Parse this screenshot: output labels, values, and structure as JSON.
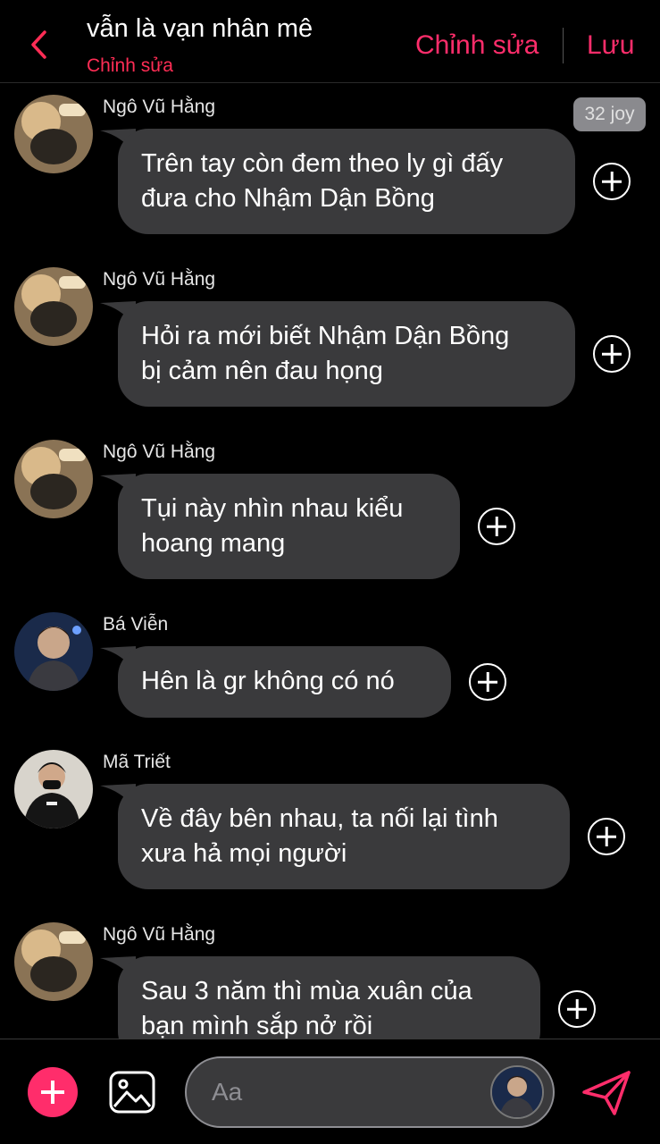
{
  "header": {
    "title": "vẫn là vạn nhân mê",
    "subtitle": "Chỉnh sửa",
    "edit_label": "Chỉnh sửa",
    "save_label": "Lưu"
  },
  "badge": "32 joy",
  "messages": [
    {
      "sender": "Ngô Vũ Hằng",
      "lines": [
        "Trên tay còn đem theo ly gì đấy",
        "đưa cho Nhậm Dận Bồng"
      ]
    },
    {
      "sender": "Ngô Vũ Hằng",
      "lines": [
        "Hỏi ra mới biết Nhậm Dận Bồng",
        "bị cảm nên đau họng"
      ]
    },
    {
      "sender": "Ngô Vũ Hằng",
      "lines": [
        "Tụi này nhìn nhau kiểu",
        "hoang mang"
      ]
    },
    {
      "sender": "Bá Viễn",
      "lines": [
        "Hên là gr không có nó"
      ]
    },
    {
      "sender": "Mã Triết",
      "lines": [
        "Về đây bên nhau, ta nối lại tình",
        "xưa hả mọi người"
      ]
    },
    {
      "sender": "Ngô Vũ Hằng",
      "lines": [
        "Sau 3 năm thì mùa xuân của",
        "bạn mình sắp nở rồi"
      ]
    }
  ],
  "composer": {
    "placeholder": "Aa"
  },
  "colors": {
    "accent": "#ff2d6b",
    "bubble": "#3a3a3c",
    "background": "#000000"
  },
  "icons": [
    "back-chevron-icon",
    "add-reaction-icon",
    "plus-icon",
    "image-icon",
    "send-icon"
  ]
}
